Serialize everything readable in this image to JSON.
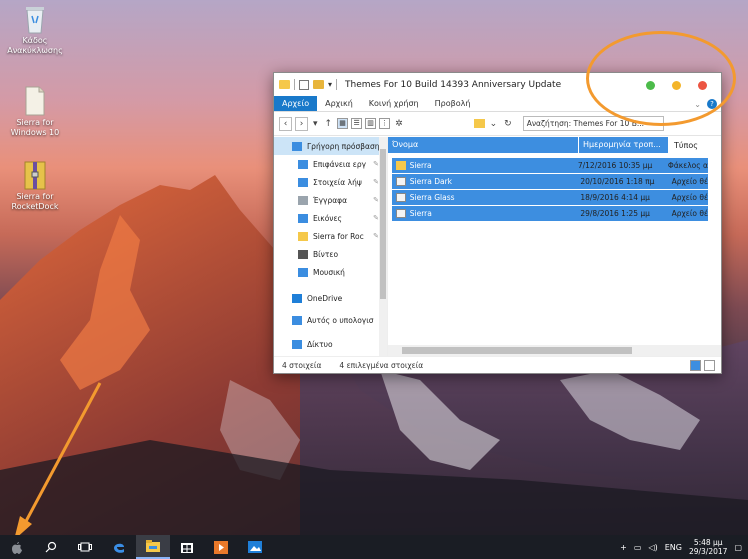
{
  "desktop": {
    "icons": [
      {
        "name": "recycle-bin",
        "label_lines": [
          "Κάδος",
          "Ανακύκλωσης"
        ]
      },
      {
        "name": "sierra-for-windows-10",
        "label_lines": [
          "Sierra for",
          "Windows 10"
        ]
      },
      {
        "name": "sierra-for-rocketdock",
        "label_lines": [
          "Sierra for",
          "RocketDock"
        ]
      }
    ]
  },
  "window": {
    "title": "Themes For 10 Build 14393 Anniversary Update",
    "traffic_lights": {
      "green": "#4cbb4a",
      "yellow": "#f4b52a",
      "red": "#ec5542"
    },
    "ribbon_tabs": [
      "Αρχείο",
      "Αρχική",
      "Κοινή χρήση",
      "Προβολή"
    ],
    "search_placeholder": "Αναζήτηση: Themes For 10 B...",
    "nav_pane": [
      {
        "label": "Γρήγορη πρόσβαση",
        "icon": "star-icon",
        "selected": true,
        "pinned": false
      },
      {
        "label": "Επιφάνεια εργ",
        "icon": "desktop-icon",
        "selected": false,
        "pinned": true
      },
      {
        "label": "Στοιχεία λήψ",
        "icon": "download-icon",
        "selected": false,
        "pinned": true
      },
      {
        "label": "Έγγραφα",
        "icon": "documents-icon",
        "selected": false,
        "pinned": true
      },
      {
        "label": "Εικόνες",
        "icon": "pictures-icon",
        "selected": false,
        "pinned": true
      },
      {
        "label": "Sierra for Roc",
        "icon": "folder-icon",
        "selected": false,
        "pinned": true
      },
      {
        "label": "Βίντεο",
        "icon": "video-icon",
        "selected": false,
        "pinned": false
      },
      {
        "label": "Μουσική",
        "icon": "music-icon",
        "selected": false,
        "pinned": false
      },
      {
        "label": "OneDrive",
        "icon": "onedrive-icon",
        "selected": false,
        "pinned": false
      },
      {
        "label": "Αυτός ο υπολογισ",
        "icon": "this-pc-icon",
        "selected": false,
        "pinned": false
      },
      {
        "label": "Δίκτυο",
        "icon": "network-icon",
        "selected": false,
        "pinned": false
      }
    ],
    "columns": {
      "name": "Όνομα",
      "date": "Ημερομηνία τροπ...",
      "type": "Τύπος"
    },
    "files": [
      {
        "name": "Sierra",
        "date": "7/12/2016 10:35 μμ",
        "type": "Φάκελος α",
        "icon": "folder-icon"
      },
      {
        "name": "Sierra Dark",
        "date": "20/10/2016 1:18 πμ",
        "type": "Αρχείο θέ",
        "icon": "theme-file-icon"
      },
      {
        "name": "Sierra Glass",
        "date": "18/9/2016 4:14 μμ",
        "type": "Αρχείο θέ",
        "icon": "theme-file-icon"
      },
      {
        "name": "Sierra",
        "date": "29/8/2016 1:25 μμ",
        "type": "Αρχείο θέ",
        "icon": "theme-file-icon"
      }
    ],
    "status": {
      "count": "4 στοιχεία",
      "selected": "4 επιλεγμένα στοιχεία"
    }
  },
  "taskbar": {
    "items": [
      "start-icon",
      "search-icon",
      "task-view-icon",
      "edge-icon",
      "file-explorer-icon",
      "store-icon",
      "media-player-icon",
      "photos-icon"
    ],
    "language": "ENG",
    "time": "5:48 μμ",
    "date": "29/3/2017"
  },
  "annotation_color": "#f39a2f"
}
